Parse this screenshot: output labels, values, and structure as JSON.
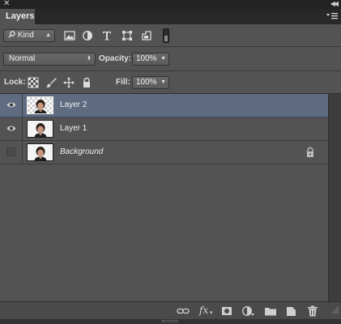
{
  "window": {
    "close_glyph": "✕",
    "collapse_glyph": "◀◀"
  },
  "tabs": [
    {
      "label": "Layers",
      "active": true
    }
  ],
  "filter": {
    "kind_label": "Kind",
    "icons": [
      "image-filter-icon",
      "adjustment-filter-icon",
      "type-filter-icon",
      "shape-filter-icon",
      "smart-object-filter-icon"
    ]
  },
  "blend": {
    "mode": "Normal",
    "opacity_label": "Opacity:",
    "opacity_value": "100%"
  },
  "lock": {
    "label": "Lock:",
    "icons": [
      "lock-transparent-pixels-icon",
      "lock-image-pixels-icon",
      "lock-position-icon",
      "lock-all-icon"
    ],
    "fill_label": "Fill:",
    "fill_value": "100%"
  },
  "layers": [
    {
      "name": "Layer 2",
      "visible": true,
      "selected": true,
      "transparent_bg": true,
      "locked": false
    },
    {
      "name": "Layer 1",
      "visible": true,
      "selected": false,
      "transparent_bg": false,
      "locked": false
    },
    {
      "name": "Background",
      "visible": false,
      "selected": false,
      "transparent_bg": false,
      "locked": true
    }
  ],
  "bottom_toolbar": {
    "buttons": [
      "link-layers-icon",
      "fx-icon",
      "layer-mask-icon",
      "adjustment-layer-icon",
      "group-folder-icon",
      "new-layer-icon",
      "delete-trash-icon"
    ],
    "fx_label": "fx"
  },
  "colors": {
    "panel_bg": "#535353",
    "selected_row": "#5e6b80",
    "header_bg": "#282828"
  }
}
